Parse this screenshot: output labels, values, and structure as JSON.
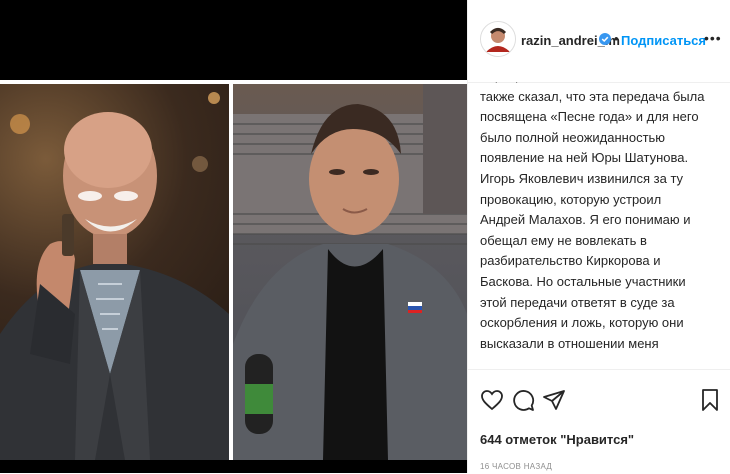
{
  "header": {
    "username": "razin_andrei_lm",
    "separator": "•",
    "follow_label": "Подписаться",
    "more_label": "•••"
  },
  "caption": {
    "text": "Киркорова и Николая Баскова. Он\nтакже сказал, что эта передача была\nпосвящена «Песне года» и для него\nбыло полной неожиданностью\nпоявление на ней Юры Шатунова.\nИгорь Яковлевич извинился за ту\nпровокацию, которую устроил\nАндрей Малахов. Я его понимаю и\nобещал ему не вовлекать в\nразбирательство Киркорова и\nБаскова. Но остальные участники\nэтой передачи ответят в суде за\nоскорбления и ложь, которую они\nвысказали в отношении меня"
  },
  "footer": {
    "likes": "644 отметок \"Нравится\"",
    "time": "16 часов назад"
  },
  "icons": {
    "like": "heart-icon",
    "comment": "comment-icon",
    "share": "paper-plane-icon",
    "save": "bookmark-icon",
    "verified": "verified-badge-icon",
    "more": "more-options-icon"
  },
  "colors": {
    "accent": "#0095f6",
    "text": "#262626",
    "muted": "#8e8e8e",
    "border": "#efefef"
  }
}
